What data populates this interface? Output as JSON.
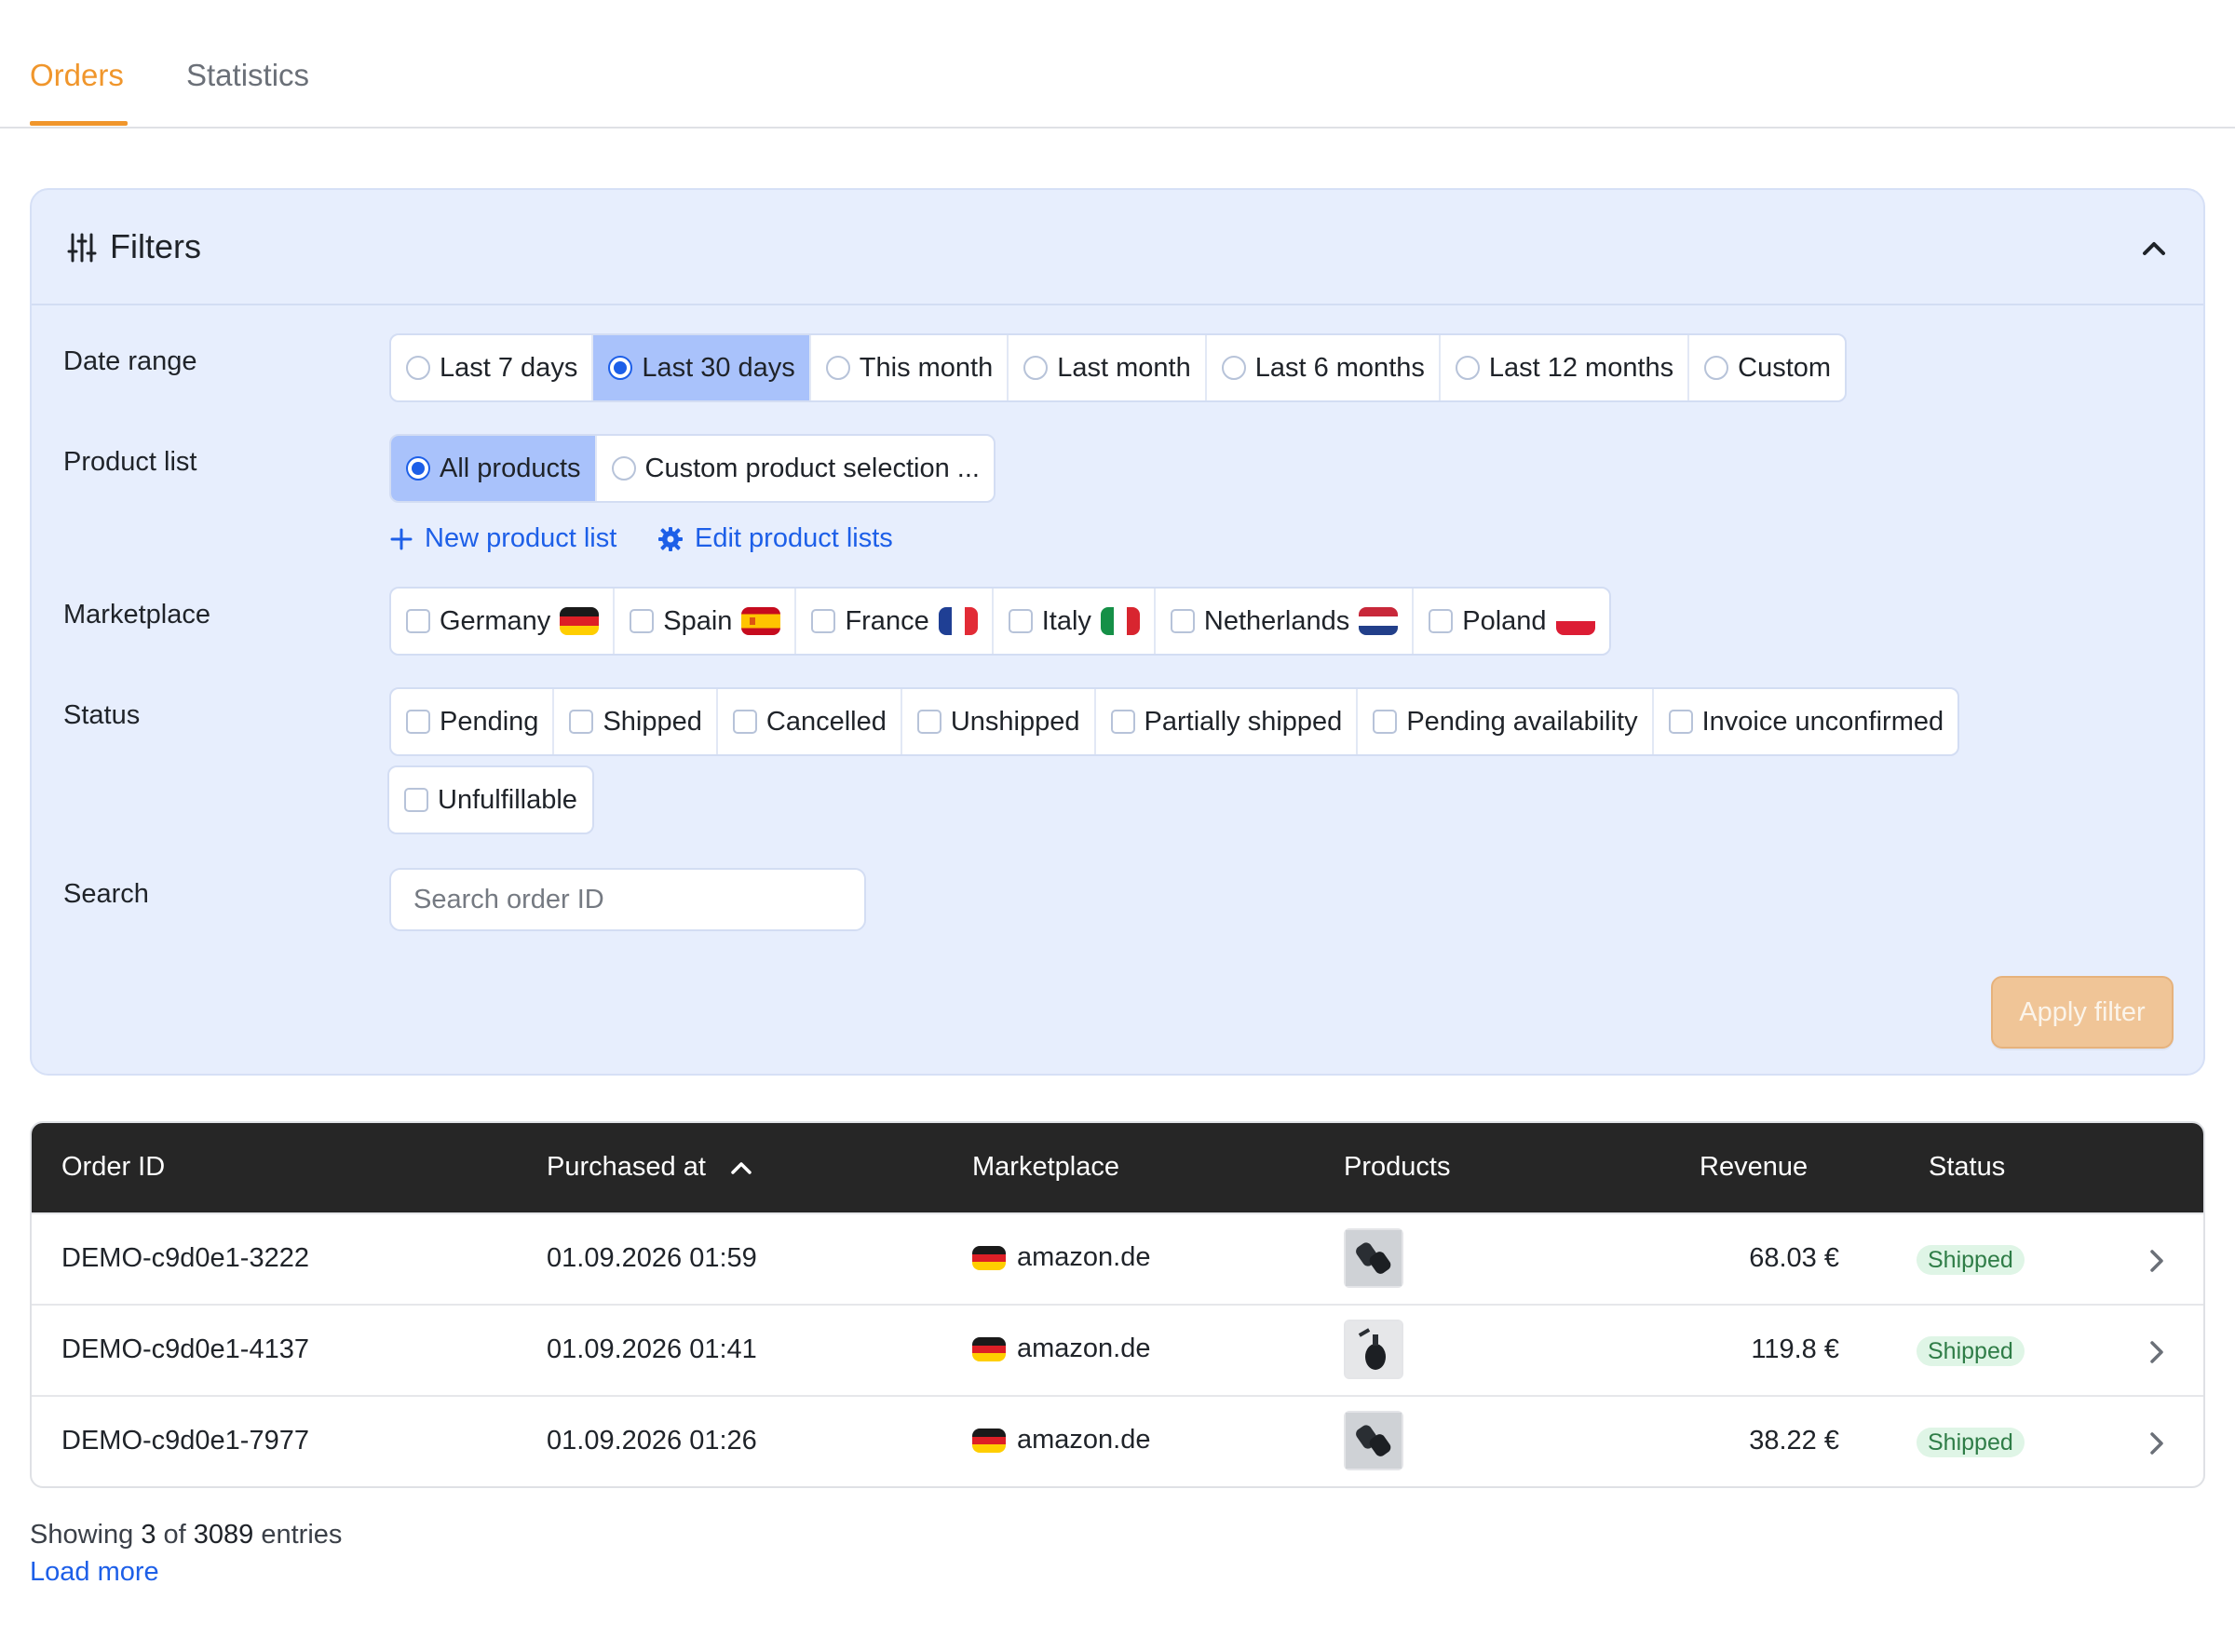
{
  "tabs": [
    {
      "label": "Orders",
      "active": true
    },
    {
      "label": "Statistics",
      "active": false
    }
  ],
  "filters": {
    "title": "Filters",
    "date_range": {
      "label": "Date range",
      "options": [
        "Last 7 days",
        "Last 30 days",
        "This month",
        "Last month",
        "Last 6 months",
        "Last 12 months",
        "Custom"
      ],
      "selected": "Last 30 days"
    },
    "product_list": {
      "label": "Product list",
      "options": [
        "All products",
        "Custom product selection ..."
      ],
      "selected": "All products",
      "new_link": "New product list",
      "edit_link": "Edit product lists"
    },
    "marketplace": {
      "label": "Marketplace",
      "options": [
        "Germany",
        "Spain",
        "France",
        "Italy",
        "Netherlands",
        "Poland"
      ]
    },
    "status": {
      "label": "Status",
      "options": [
        "Pending",
        "Shipped",
        "Cancelled",
        "Unshipped",
        "Partially shipped",
        "Pending availability",
        "Invoice unconfirmed",
        "Unfulfillable"
      ]
    },
    "search": {
      "label": "Search",
      "placeholder": "Search order ID",
      "value": ""
    },
    "apply_label": "Apply filter"
  },
  "table": {
    "headers": [
      "Order ID",
      "Purchased at",
      "Marketplace",
      "Products",
      "Revenue",
      "Status"
    ],
    "sort_column": "Purchased at",
    "rows": [
      {
        "order_id": "DEMO-c9d0e1-3222",
        "purchased_at": "01.09.2026 01:59",
        "marketplace": "amazon.de",
        "revenue": "68.03 €",
        "status": "Shipped"
      },
      {
        "order_id": "DEMO-c9d0e1-4137",
        "purchased_at": "01.09.2026 01:41",
        "marketplace": "amazon.de",
        "revenue": "119.8 €",
        "status": "Shipped"
      },
      {
        "order_id": "DEMO-c9d0e1-7977",
        "purchased_at": "01.09.2026 01:26",
        "marketplace": "amazon.de",
        "revenue": "38.22 €",
        "status": "Shipped"
      }
    ]
  },
  "footer": {
    "showing_prefix": "Showing",
    "shown": "3",
    "of": "of",
    "total": "3089",
    "suffix": "entries",
    "load_more": "Load more"
  },
  "colors": {
    "accent": "#f0962c",
    "link": "#1d5fe8",
    "panel": "#e7eefd",
    "selected": "#a9c2fb",
    "header": "#262626",
    "badge_bg": "#dff5e6",
    "badge_text": "#2f7d47"
  }
}
